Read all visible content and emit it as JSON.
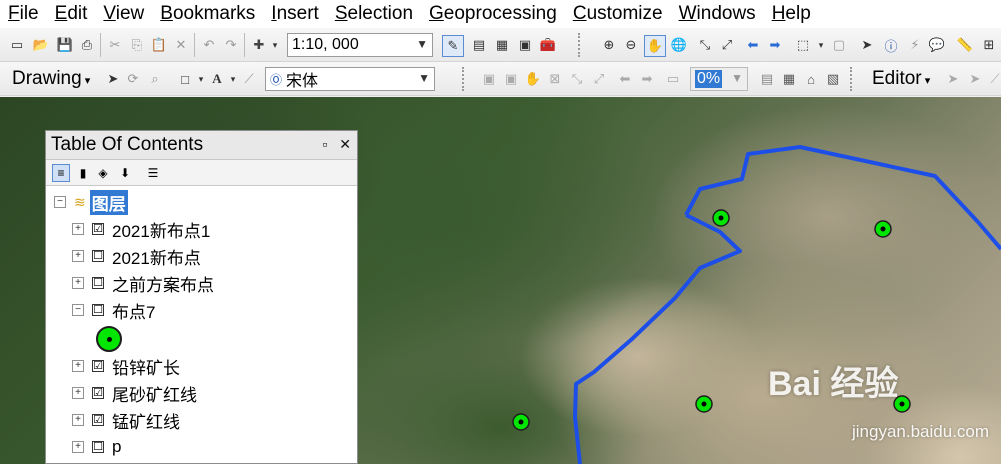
{
  "menubar": {
    "items": [
      {
        "label": "File",
        "ul": "F"
      },
      {
        "label": "Edit",
        "ul": "E"
      },
      {
        "label": "View",
        "ul": "V"
      },
      {
        "label": "Bookmarks",
        "ul": "B"
      },
      {
        "label": "Insert",
        "ul": "I"
      },
      {
        "label": "Selection",
        "ul": "S"
      },
      {
        "label": "Geoprocessing",
        "ul": "G"
      },
      {
        "label": "Customize",
        "ul": "C"
      },
      {
        "label": "Windows",
        "ul": "W"
      },
      {
        "label": "Help",
        "ul": "H"
      }
    ]
  },
  "standard_toolbar": {
    "scale_value": "1:10, 000"
  },
  "draw_toolbar": {
    "drawing_label": "Drawing",
    "font_value": "宋体",
    "zoom_percent": "0%",
    "editor_label": "Editor"
  },
  "toc": {
    "title": "Table Of Contents",
    "root_label": "图层",
    "layers": [
      {
        "label": "2021新布点1",
        "checked": "☑",
        "expanded": "+"
      },
      {
        "label": "2021新布点",
        "checked": "☐",
        "expanded": "+"
      },
      {
        "label": "之前方案布点",
        "checked": "☐",
        "expanded": "+"
      },
      {
        "label": "布点7",
        "checked": "☐",
        "expanded": "−"
      },
      {
        "label": "铅锌矿长",
        "checked": "☑",
        "expanded": "+"
      },
      {
        "label": "尾砂矿红线",
        "checked": "☑",
        "expanded": "+"
      },
      {
        "label": "锰矿红线",
        "checked": "☑",
        "expanded": "+"
      },
      {
        "label": "p",
        "checked": "☐",
        "expanded": "+"
      }
    ]
  },
  "map": {
    "boundary_color": "#1d4fe8",
    "point_color": "#00e600"
  },
  "watermark": {
    "main": "Bai 经验",
    "sub": "jingyan.baidu.com"
  }
}
